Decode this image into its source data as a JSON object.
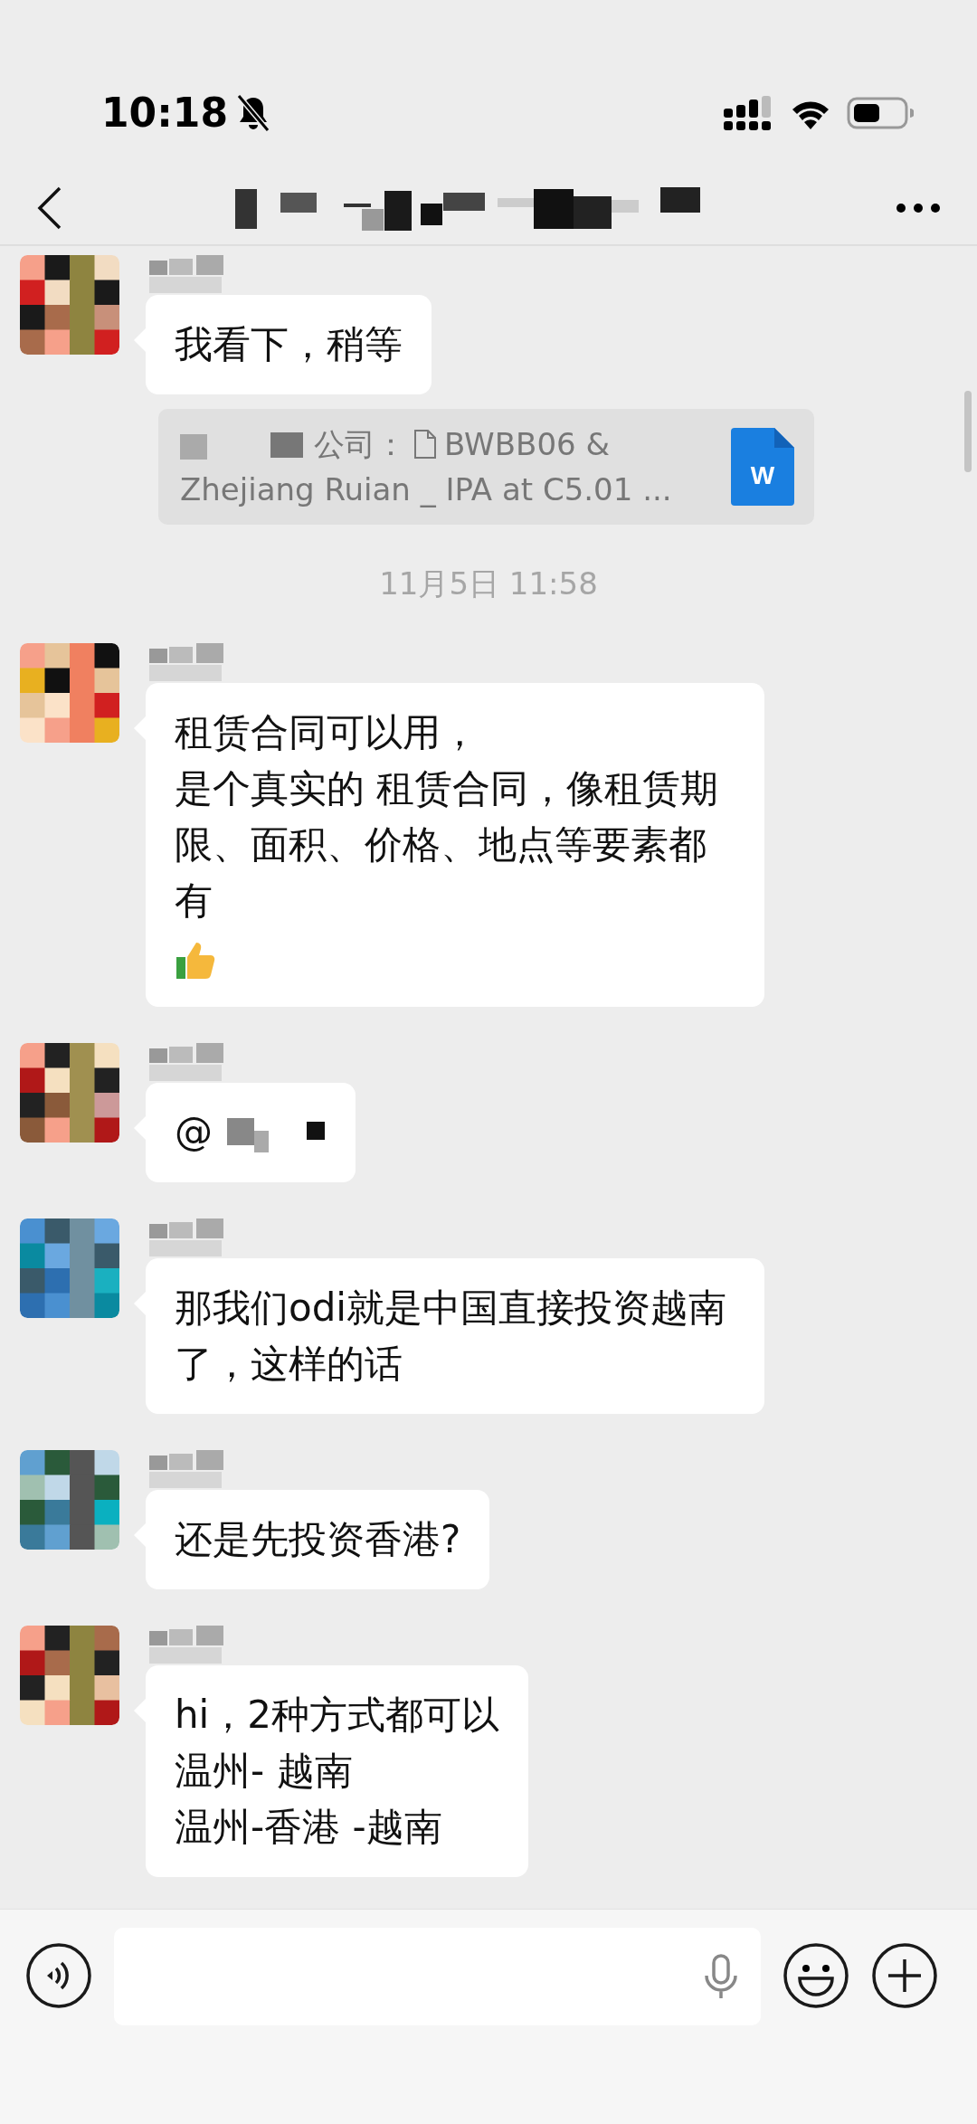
{
  "status_bar": {
    "time": "10:18"
  },
  "items": [
    {
      "kind": "message",
      "lines": [
        "我看下，稍等"
      ]
    },
    {
      "kind": "quote",
      "prefix": "公司：",
      "file_name": "BWBB06  &",
      "line2": "Zhejiang Ruian _ IPA at C5.01 ...",
      "file_badge": "W"
    },
    {
      "kind": "time",
      "text": "11月5日 11:58"
    },
    {
      "kind": "message",
      "lines": [
        "租赁合同可以用，",
        "是个真实的 租赁合同，像租赁期限、面积、价格、地点等要素都有"
      ],
      "thumbs_up": true
    },
    {
      "kind": "message",
      "lines": [
        "@"
      ],
      "redacted": true
    },
    {
      "kind": "message",
      "lines": [
        "那我们odi就是中国直接投资越南了，这样的话"
      ]
    },
    {
      "kind": "message",
      "lines": [
        "还是先投资香港?"
      ]
    },
    {
      "kind": "message",
      "lines": [
        "hi，2种方式都可以",
        "温州- 越南",
        "温州-香港 -越南"
      ]
    }
  ]
}
